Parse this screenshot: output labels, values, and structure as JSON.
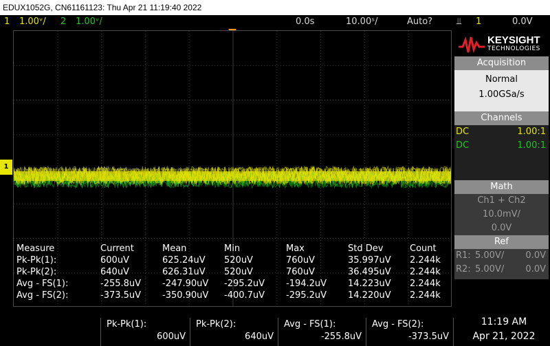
{
  "title": "EDUX1052G, CN61161123: Thu Apr 21 11:19:40 2022",
  "status": {
    "ch1_num": "1",
    "ch1_scale": "1.00ᵛ/",
    "ch2_num": "2",
    "ch2_scale": "1.00ᵛ/",
    "time_offset": "0.0s",
    "time_scale": "10.00ˢ/",
    "trigger_mode": "Auto?",
    "trigger_symbol": "⫫",
    "trigger_source": "1",
    "trigger_level": "0.0V"
  },
  "ground_marker": "1",
  "measurements": {
    "headers": [
      "Measure",
      "Current",
      "Mean",
      "Min",
      "Max",
      "Std Dev",
      "Count"
    ],
    "rows": [
      [
        "Pk-Pk(1):",
        "600uV",
        "625.24uV",
        "520uV",
        "760uV",
        "35.997uV",
        "2.244k"
      ],
      [
        "Pk-Pk(2):",
        "640uV",
        "626.31uV",
        "520uV",
        "760uV",
        "36.495uV",
        "2.244k"
      ],
      [
        "Avg - FS(1):",
        "-255.8uV",
        "-247.90uV",
        "-295.2uV",
        "-194.2uV",
        "14.223uV",
        "2.244k"
      ],
      [
        "Avg - FS(2):",
        "-373.5uV",
        "-350.90uV",
        "-400.7uV",
        "-295.2uV",
        "14.220uV",
        "2.244k"
      ]
    ]
  },
  "brand": {
    "name": "KEYSIGHT",
    "sub": "TECHNOLOGIES"
  },
  "acquisition": {
    "title": "Acquisition",
    "mode": "Normal",
    "rate": "1.00GSa/s"
  },
  "channels": {
    "title": "Channels",
    "ch1_coupling": "DC",
    "ch1_probe": "1.00:1",
    "ch2_coupling": "DC",
    "ch2_probe": "1.00:1"
  },
  "math": {
    "title": "Math",
    "func": "Ch1 + Ch2",
    "scale": "10.0mV/",
    "offset": "0.0V"
  },
  "ref": {
    "title": "Ref",
    "r1_label": "R1:",
    "r1_scale": "5.00V/",
    "r1_offset": "0.0V",
    "r2_label": "R2:",
    "r2_scale": "5.00V/",
    "r2_offset": "0.0V"
  },
  "softkeys": [
    {
      "label": "Pk-Pk(1):",
      "value": "600uV"
    },
    {
      "label": "Pk-Pk(2):",
      "value": "640uV"
    },
    {
      "label": "Avg - FS(1):",
      "value": "-255.8uV"
    },
    {
      "label": "Avg - FS(2):",
      "value": "-373.5uV"
    }
  ],
  "clock": {
    "time": "11:19 AM",
    "date": "Apr 21, 2022"
  },
  "colors": {
    "ch1": "#e6e600",
    "ch2": "#22c322",
    "trigger": "#ff9a1a",
    "grid": "#3a3a3a"
  }
}
